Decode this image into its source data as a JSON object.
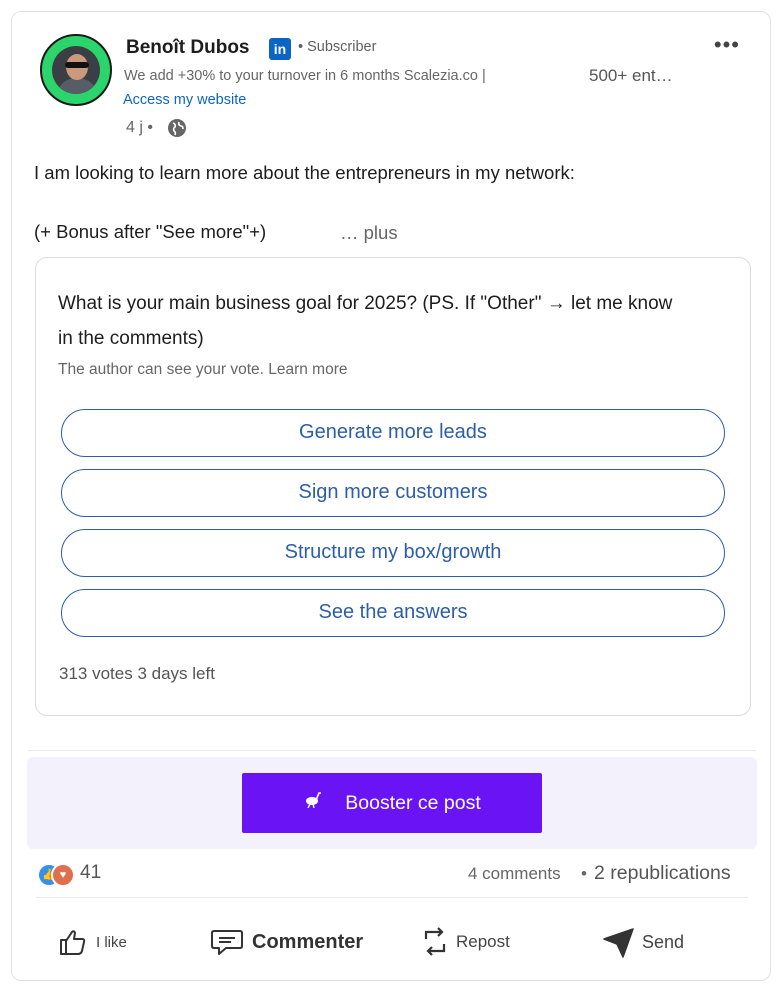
{
  "author": {
    "name": "Benoît Dubos",
    "linkedin_badge": "in",
    "relation": "• Subscriber",
    "headline": "We add +30% to your turnover in 6 months Scalezia.co |",
    "followers": "500+ ent…",
    "website_link": "Access my website",
    "time": "4 j •"
  },
  "menu_icon_text": "•••",
  "post": {
    "line1": "I am looking to learn more about the entrepreneurs in my network:",
    "line2": "(+ Bonus after \"See more\"+)",
    "see_more": "… plus"
  },
  "poll": {
    "question": "What is your main business goal for 2025? (PS. If \"Other\" → let me know in the comments)",
    "note": "The author can see your vote. Learn more",
    "options": [
      "Generate more leads",
      "Sign more customers",
      "Structure my box/growth",
      "See the answers"
    ],
    "stats": "313 votes 3 days left"
  },
  "boost": {
    "label": "Booster ce post",
    "icon": "ostrich-icon",
    "color": "#6a14f5"
  },
  "social": {
    "reaction_count": "41",
    "comments": "4 comments",
    "separator": "•",
    "reposts": "2 republications"
  },
  "actions": {
    "like": "I like",
    "comment": "Commenter",
    "repost": "Repost",
    "send": "Send"
  },
  "colors": {
    "link": "#0a66c2",
    "poll_option": "#2d5ea8",
    "avatar_ring": "#2bd56b"
  }
}
